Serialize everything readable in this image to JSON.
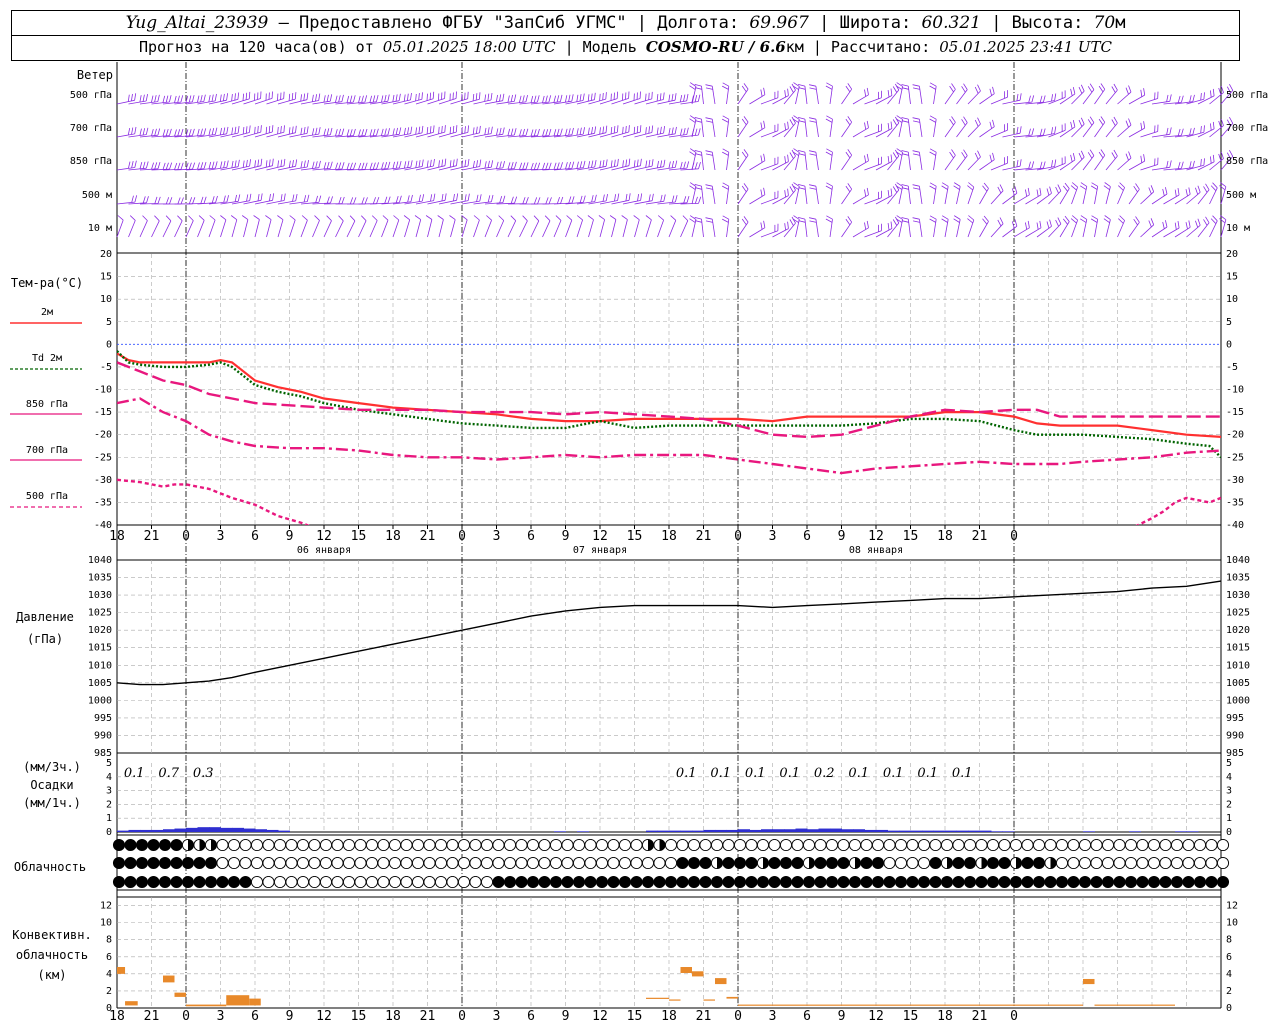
{
  "header": {
    "station": "Yug_Altai_23939",
    "provider": " – Предоставлено ФГБУ \"ЗапСиб УГМС\" | Долгота: ",
    "lon": "69.967",
    "lat_label": " | Широта: ",
    "lat": "60.321",
    "alt_label": " | Высота: ",
    "alt": "70",
    "alt_unit": "м",
    "forecast_label": "Прогноз на 120 часа(ов) от ",
    "forecast_from": "05.01.2025 18:00 UTC",
    "model_label": "  | Модель ",
    "model": "COSMO-RU / 6.6",
    "model_unit": "км",
    "calc_label": " | Рассчитано: ",
    "calc_time": "05.01.2025 23:41 UTC"
  },
  "wind_panel": {
    "title": "Ветер",
    "levels": [
      "500 гПа",
      "700 гПа",
      "850 гПа",
      "500 м",
      "10  м"
    ],
    "color": "#8a2be2"
  },
  "temp_panel": {
    "ylabel": "Тем-ра(°C)",
    "ylim": [
      -40,
      20
    ],
    "yticks": [
      20,
      15,
      10,
      5,
      0,
      -5,
      -10,
      -15,
      -20,
      -25,
      -30,
      -35,
      -40
    ]
  },
  "pressure_panel": {
    "ylabel_1": "Давление",
    "ylabel_2": "(гПа)",
    "ylim": [
      985,
      1040
    ],
    "yticks": [
      1040,
      1035,
      1030,
      1025,
      1020,
      1015,
      1010,
      1005,
      1000,
      995,
      990,
      985
    ]
  },
  "precip_panel": {
    "ylabel_1": "(мм/3ч.)",
    "ylabel_2": "Осадки",
    "ylabel_3": "(мм/1ч.)",
    "ylim": [
      0,
      5
    ],
    "yticks": [
      5,
      4,
      3,
      2,
      1,
      0
    ],
    "amounts": [
      {
        "h": 3,
        "t": "0.1"
      },
      {
        "h": 6,
        "t": "0.7"
      },
      {
        "h": 9,
        "t": "0.3"
      },
      {
        "h": 51,
        "t": "0.1"
      },
      {
        "h": 54,
        "t": "0.1"
      },
      {
        "h": 57,
        "t": "0.1"
      },
      {
        "h": 60,
        "t": "0.1"
      },
      {
        "h": 63,
        "t": "0.2"
      },
      {
        "h": 66,
        "t": "0.1"
      },
      {
        "h": 69,
        "t": "0.1"
      },
      {
        "h": 72,
        "t": "0.1"
      },
      {
        "h": 75,
        "t": "0.1"
      }
    ]
  },
  "cloud_panel": {
    "label": "Облачность"
  },
  "conv_panel": {
    "ylabel_1": "Конвективн.",
    "ylabel_2": "облачность",
    "ylabel_3": "(км)",
    "ylim": [
      0,
      13
    ],
    "yticks": [
      12,
      10,
      8,
      6,
      4,
      2,
      0
    ],
    "color": "#e8892a"
  },
  "x_axis": {
    "hour_labels": [
      "18",
      "21",
      "0",
      "3",
      "6",
      "9",
      "12",
      "15",
      "18",
      "21",
      "0",
      "3",
      "6",
      "9",
      "12",
      "15",
      "18",
      "21",
      "0",
      "3",
      "6",
      "9",
      "12",
      "15",
      "18",
      "21",
      "0"
    ],
    "day_labels": [
      {
        "h": 18,
        "t": "06 января"
      },
      {
        "h": 42,
        "t": "07 января"
      },
      {
        "h": 66,
        "t": "08 января"
      }
    ]
  },
  "chart_data": [
    {
      "type": "line",
      "title": "Тем-ра(°C)",
      "x_unit": "hours since 05.01.2025 18:00 UTC",
      "ylim": [
        -40,
        20
      ],
      "series": [
        {
          "name": "2м",
          "color": "#ff3030",
          "dash": "solid",
          "x": [
            0,
            1,
            2,
            4,
            6,
            8,
            9,
            10,
            12,
            14,
            16,
            18,
            21,
            24,
            27,
            30,
            33,
            36,
            39,
            42,
            45,
            48,
            51,
            54,
            57,
            60,
            63,
            66,
            69,
            72,
            75,
            78,
            80,
            82,
            84,
            87,
            90,
            93,
            96
          ],
          "y": [
            -2,
            -3.5,
            -4,
            -4,
            -4,
            -4,
            -3.5,
            -4,
            -8,
            -9.5,
            -10.5,
            -12,
            -13,
            -14,
            -14.5,
            -15,
            -15.5,
            -16.5,
            -17,
            -17,
            -16.5,
            -16.5,
            -16.5,
            -16.5,
            -17,
            -16,
            -16,
            -16,
            -16,
            -15,
            -15,
            -16,
            -17.5,
            -18,
            -18,
            -18,
            -19,
            -20,
            -20.5
          ]
        },
        {
          "name": "Td 2м",
          "color": "#006400",
          "dash": "dot",
          "x": [
            0,
            1,
            2,
            4,
            6,
            8,
            9,
            10,
            12,
            14,
            16,
            18,
            21,
            24,
            27,
            30,
            33,
            36,
            39,
            42,
            45,
            48,
            51,
            54,
            57,
            60,
            63,
            66,
            69,
            72,
            75,
            78,
            80,
            82,
            84,
            87,
            90,
            93,
            95,
            96
          ],
          "y": [
            -1.5,
            -4,
            -4.5,
            -5,
            -5,
            -4.5,
            -4,
            -5,
            -9,
            -10.5,
            -11.5,
            -13,
            -14.5,
            -15.5,
            -16.5,
            -17.5,
            -18,
            -18.5,
            -18.5,
            -17,
            -18.5,
            -18,
            -18,
            -18,
            -18,
            -18,
            -18,
            -17.5,
            -16.5,
            -16.5,
            -17,
            -19,
            -20,
            -20,
            -20,
            -20.5,
            -21,
            -22,
            -22.5,
            -25
          ]
        },
        {
          "name": "850 гПа",
          "color": "#e8177e",
          "dash": "longdash",
          "x": [
            0,
            2,
            4,
            6,
            8,
            10,
            12,
            15,
            18,
            21,
            24,
            27,
            30,
            33,
            36,
            39,
            42,
            45,
            48,
            51,
            54,
            57,
            60,
            63,
            66,
            69,
            72,
            75,
            78,
            80,
            82,
            84,
            87,
            90,
            93,
            96
          ],
          "y": [
            -4,
            -6,
            -8,
            -9,
            -11,
            -12,
            -13,
            -13.5,
            -14,
            -14.5,
            -14.5,
            -14.5,
            -15,
            -15,
            -15,
            -15.5,
            -15,
            -15.5,
            -16,
            -16.5,
            -18,
            -20,
            -20.5,
            -20,
            -18,
            -16,
            -14.5,
            -15,
            -14.5,
            -14.5,
            -16,
            -16,
            -16,
            -16,
            -16,
            -16
          ]
        },
        {
          "name": "700 гПа",
          "color": "#e8177e",
          "dash": "dashdot",
          "x": [
            0,
            2,
            4,
            6,
            8,
            10,
            12,
            15,
            18,
            21,
            24,
            27,
            30,
            33,
            36,
            39,
            42,
            45,
            48,
            51,
            54,
            57,
            60,
            63,
            66,
            69,
            72,
            75,
            78,
            80,
            82,
            84,
            87,
            90,
            93,
            96
          ],
          "y": [
            -13,
            -12,
            -15,
            -17,
            -20,
            -21.5,
            -22.5,
            -23,
            -23,
            -23.5,
            -24.5,
            -25,
            -25,
            -25.5,
            -25,
            -24.5,
            -25,
            -24.5,
            -24.5,
            -24.5,
            -25.5,
            -26.5,
            -27.5,
            -28.5,
            -27.5,
            -27,
            -26.5,
            -26,
            -26.5,
            -26.5,
            -26.5,
            -26,
            -25.5,
            -25,
            -24,
            -23.5
          ]
        },
        {
          "name": "500 гПа",
          "color": "#e8177e",
          "dash": "shortdash",
          "x": [
            0,
            2,
            4,
            5,
            6,
            8,
            10,
            12,
            14,
            16,
            17.5
          ],
          "y": [
            -30,
            -30.5,
            -31.5,
            -31,
            -31,
            -32,
            -34,
            -35.5,
            -38,
            -39.5,
            -41
          ]
        },
        {
          "name": "500 гПа (cont.)",
          "color": "#e8177e",
          "dash": "shortdash",
          "x": [
            88,
            90,
            91,
            92,
            93,
            94,
            95,
            96
          ],
          "y": [
            -41,
            -38.5,
            -37,
            -35,
            -34,
            -34.5,
            -35,
            -34
          ]
        }
      ]
    },
    {
      "type": "line",
      "title": "Давление (гПа)",
      "x_unit": "hours since 05.01.2025 18:00 UTC",
      "ylim": [
        985,
        1040
      ],
      "series": [
        {
          "name": "Давление",
          "color": "#000000",
          "x": [
            0,
            2,
            4,
            6,
            8,
            10,
            12,
            15,
            18,
            21,
            24,
            27,
            30,
            33,
            36,
            39,
            42,
            45,
            48,
            51,
            54,
            57,
            60,
            63,
            66,
            69,
            72,
            75,
            78,
            81,
            84,
            87,
            90,
            93,
            96
          ],
          "y": [
            1005,
            1004.5,
            1004.5,
            1005,
            1005.5,
            1006.5,
            1008,
            1010,
            1012,
            1014,
            1016,
            1018,
            1020,
            1022,
            1024,
            1025.5,
            1026.5,
            1027,
            1027,
            1027,
            1027,
            1026.5,
            1027,
            1027.5,
            1028,
            1028.5,
            1029,
            1029,
            1029.5,
            1030,
            1030.5,
            1031,
            1032,
            1032.5,
            1034
          ]
        }
      ]
    },
    {
      "type": "bar",
      "title": "Осадки (мм/1ч.)",
      "x_unit": "hours since 05.01.2025 18:00 UTC",
      "ylim": [
        0,
        5
      ],
      "series": [
        {
          "name": "Осадки",
          "color": "#2f2fd0",
          "x": [
            0,
            1,
            2,
            3,
            4,
            5,
            6,
            7,
            8,
            9,
            10,
            11,
            12,
            13,
            14,
            38,
            40,
            46,
            47,
            48,
            49,
            50,
            51,
            52,
            53,
            54,
            55,
            56,
            57,
            58,
            59,
            60,
            61,
            62,
            63,
            64,
            65,
            66,
            67,
            68,
            69,
            70,
            71,
            72,
            73,
            74,
            75,
            76,
            77,
            84,
            88,
            92,
            93
          ],
          "y": [
            0.1,
            0.15,
            0.15,
            0.15,
            0.2,
            0.25,
            0.3,
            0.35,
            0.35,
            0.3,
            0.3,
            0.25,
            0.2,
            0.15,
            0.1,
            0.05,
            0.05,
            0.1,
            0.1,
            0.1,
            0.1,
            0.1,
            0.15,
            0.15,
            0.15,
            0.2,
            0.15,
            0.2,
            0.2,
            0.2,
            0.25,
            0.2,
            0.25,
            0.25,
            0.2,
            0.2,
            0.15,
            0.15,
            0.1,
            0.1,
            0.1,
            0.1,
            0.1,
            0.1,
            0.1,
            0.1,
            0.1,
            0.05,
            0.05,
            0.05,
            0.05,
            0.05,
            0.05
          ]
        }
      ]
    },
    {
      "type": "bar",
      "title": "Конвективн. облачность (км)",
      "x_unit": "hours since 05.01.2025 18:00 UTC",
      "ylim": [
        0,
        13
      ],
      "segments": [
        {
          "x0": 0,
          "x1": 0.7,
          "base": 4,
          "top": 4.8
        },
        {
          "x0": 0.7,
          "x1": 1.8,
          "base": 0.3,
          "top": 0.8
        },
        {
          "x0": 4,
          "x1": 5,
          "base": 3,
          "top": 3.8
        },
        {
          "x0": 5,
          "x1": 6,
          "base": 1.3,
          "top": 1.8
        },
        {
          "x0": 6,
          "x1": 9.5,
          "base": 0.2,
          "top": 0.4
        },
        {
          "x0": 9.5,
          "x1": 11.5,
          "base": 0.3,
          "top": 1.5
        },
        {
          "x0": 11.5,
          "x1": 12.5,
          "base": 0.3,
          "top": 1.1
        },
        {
          "x0": 46,
          "x1": 48,
          "base": 1.1,
          "top": 1.2
        },
        {
          "x0": 48,
          "x1": 49,
          "base": 0.9,
          "top": 1.0
        },
        {
          "x0": 49,
          "x1": 50,
          "base": 4.1,
          "top": 4.8
        },
        {
          "x0": 50,
          "x1": 51,
          "base": 3.7,
          "top": 4.3
        },
        {
          "x0": 51,
          "x1": 52,
          "base": 0.9,
          "top": 1.0
        },
        {
          "x0": 52,
          "x1": 53,
          "base": 2.8,
          "top": 3.5
        },
        {
          "x0": 53,
          "x1": 54,
          "base": 1.1,
          "top": 1.3
        },
        {
          "x0": 54,
          "x1": 84,
          "base": 0.3,
          "top": 0.4
        },
        {
          "x0": 84,
          "x1": 85,
          "base": 2.8,
          "top": 3.4
        },
        {
          "x0": 85,
          "x1": 92,
          "base": 0.3,
          "top": 0.4
        }
      ]
    }
  ]
}
